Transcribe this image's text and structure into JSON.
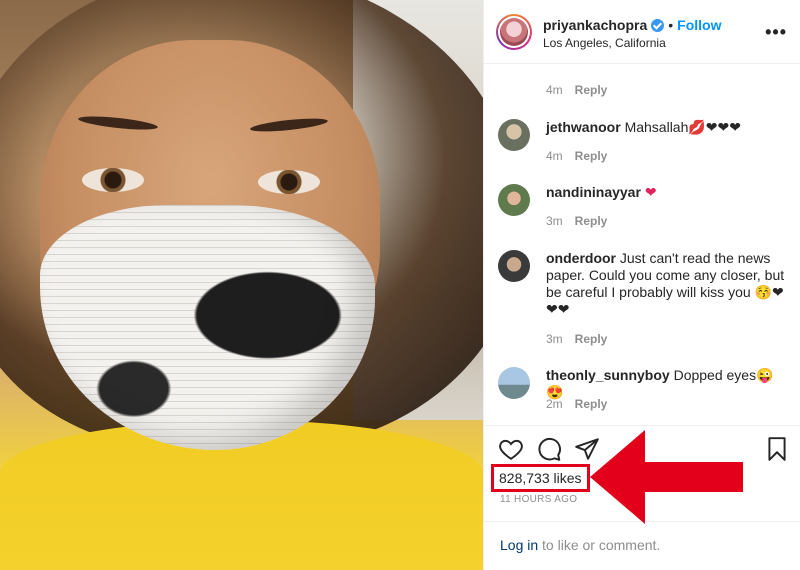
{
  "post": {
    "username": "priyankachopra",
    "follow_label": "Follow",
    "separator": "•",
    "location": "Los Angeles, California",
    "more_label": "•••"
  },
  "comments": {
    "partial": {
      "time": "4m",
      "reply": "Reply"
    },
    "items": [
      {
        "user": "jethwanoor",
        "text": "Mahsallah💋❤❤❤",
        "time": "4m",
        "reply": "Reply"
      },
      {
        "user": "nandininayyar",
        "text": "❤",
        "time": "3m",
        "reply": "Reply"
      },
      {
        "user": "onderdoor",
        "text": "Just can't read the news paper. Could you come any closer, but be careful I probably will kiss you 😚❤❤❤",
        "time": "3m",
        "reply": "Reply"
      },
      {
        "user": "theonly_sunnyboy",
        "text": "Dopped eyes😜😍",
        "time": "2m",
        "reply": "Reply"
      }
    ]
  },
  "engagement": {
    "likes": "828,733 likes",
    "time_ago": "11 HOURS AGO",
    "login_link": "Log in",
    "login_suffix": " to like or comment."
  },
  "colors": {
    "highlight": "#e3001b",
    "link": "#0095f6",
    "verified": "#3897f0"
  }
}
